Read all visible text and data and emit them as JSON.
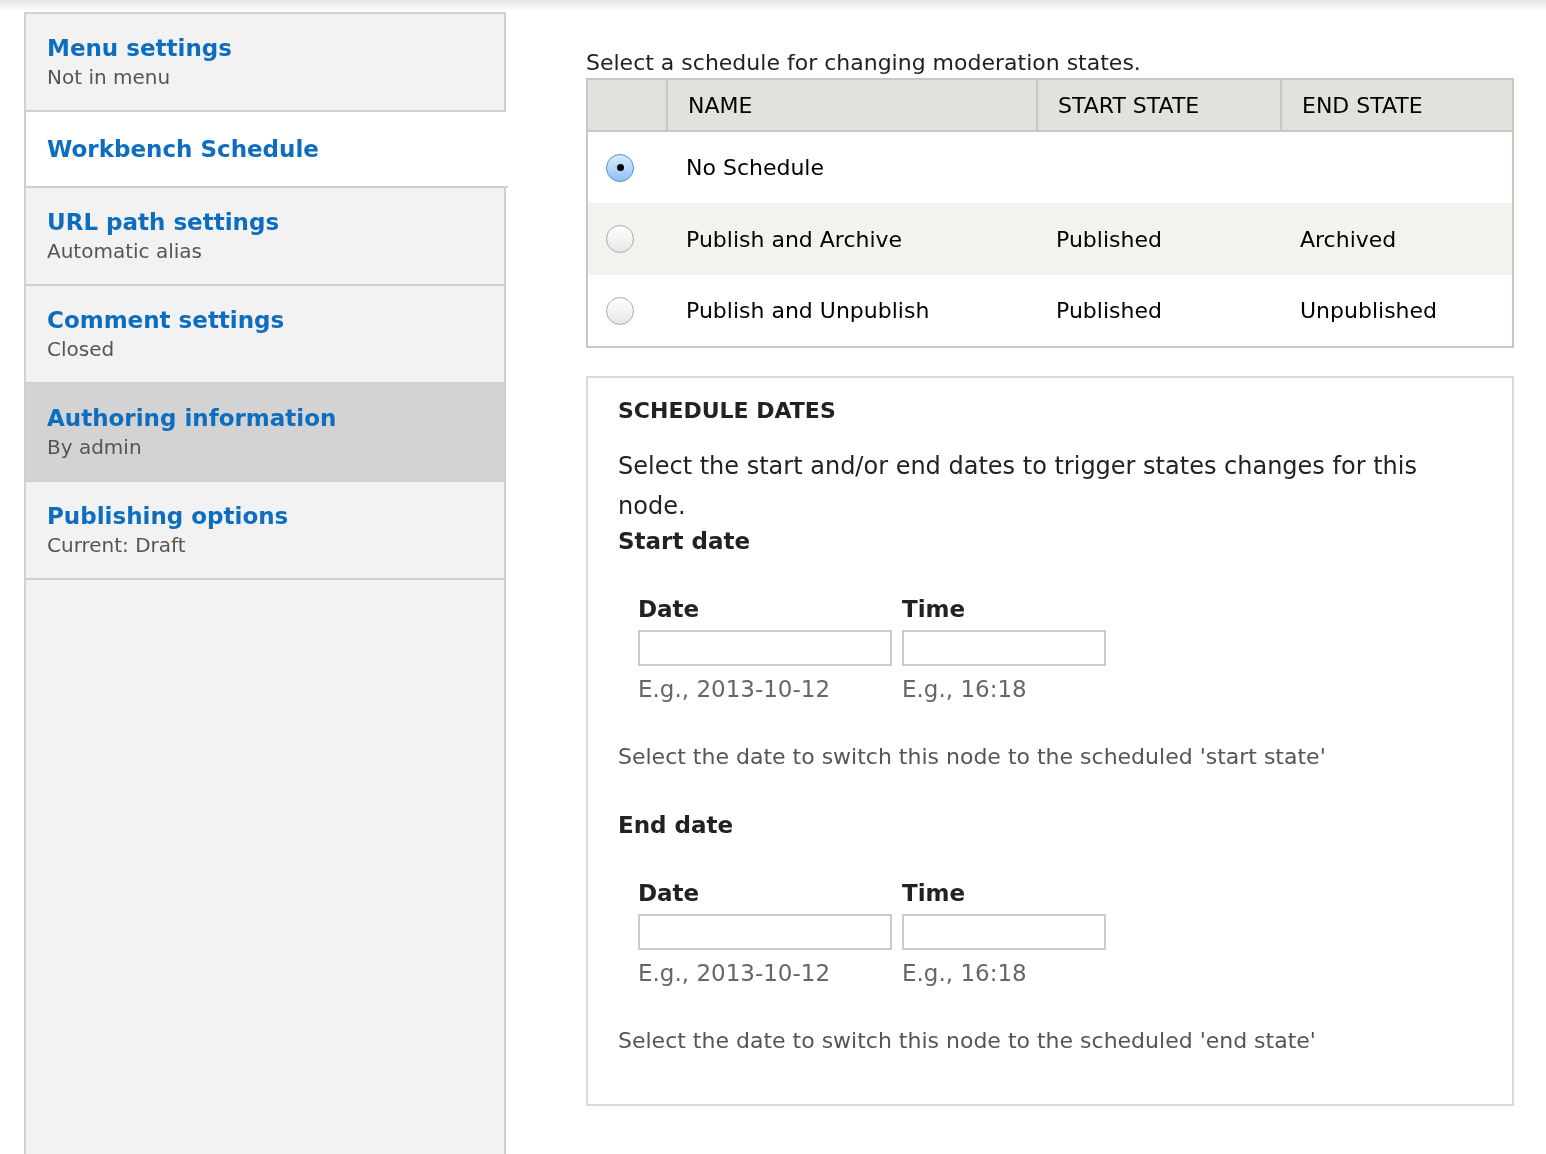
{
  "sidebar": {
    "items": [
      {
        "title": "Menu settings",
        "summary": "Not in menu",
        "selected": false,
        "hovered": false
      },
      {
        "title": "Workbench Schedule",
        "selected": true,
        "hovered": false
      },
      {
        "title": "URL path settings",
        "summary": "Automatic alias",
        "selected": false,
        "hovered": false
      },
      {
        "title": "Comment settings",
        "summary": "Closed",
        "selected": false,
        "hovered": false
      },
      {
        "title": "Authoring information",
        "summary": "By admin",
        "selected": false,
        "hovered": true
      },
      {
        "title": "Publishing options",
        "summary": "Current: Draft",
        "selected": false,
        "hovered": false
      }
    ]
  },
  "schedule_intro": "Select a schedule for changing moderation states.",
  "table": {
    "columns": [
      "NAME",
      "START STATE",
      "END STATE"
    ],
    "rows": [
      {
        "name": "No Schedule",
        "start_state": "",
        "end_state": "",
        "selected": true
      },
      {
        "name": "Publish and Archive",
        "start_state": "Published",
        "end_state": "Archived",
        "selected": false
      },
      {
        "name": "Publish and Unpublish",
        "start_state": "Published",
        "end_state": "Unpublished",
        "selected": false
      }
    ]
  },
  "schedule_dates": {
    "title": "SCHEDULE DATES",
    "description": "Select the start and/or end dates to trigger states changes for this node.",
    "groups": [
      {
        "label": "Start date",
        "date_label": "Date",
        "time_label": "Time",
        "date_hint": "E.g., 2013-10-12",
        "time_hint": "E.g., 16:18",
        "description": "Select the date to switch this node to the scheduled 'start state'"
      },
      {
        "label": "End date",
        "date_label": "Date",
        "time_label": "Time",
        "date_hint": "E.g., 2013-10-12",
        "time_hint": "E.g., 16:18",
        "description": "Select the date to switch this node to the scheduled 'end state'"
      }
    ]
  }
}
